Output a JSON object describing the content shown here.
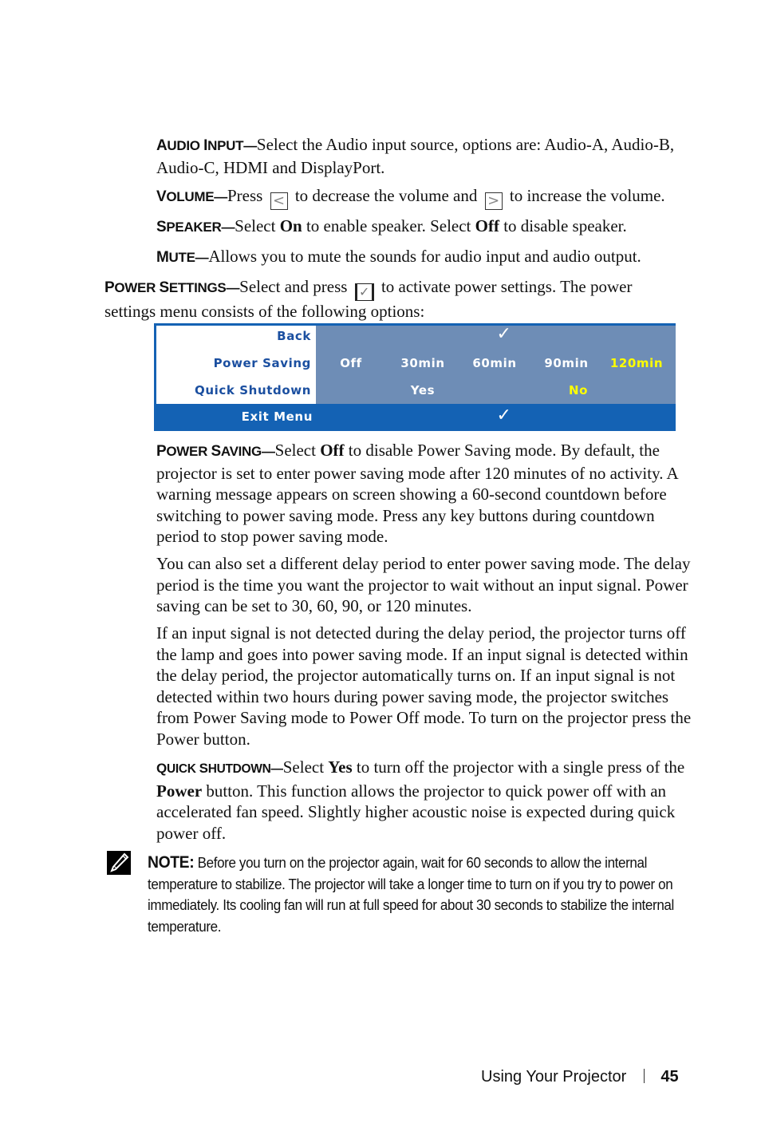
{
  "sections": {
    "audio_input": {
      "heading_first": "A",
      "heading_rest": "UDIO ",
      "heading_first2": "I",
      "heading_rest2": "NPUT",
      "dash": "—",
      "text": "Select the Audio input source, options are: Audio-A, Audio-B, Audio-C, HDMI and DisplayPort."
    },
    "volume": {
      "heading_first": "V",
      "heading_rest": "OLUME",
      "dash": "—",
      "text_before": "Press",
      "left_icon": "left-arrow-icon",
      "left_glyph": "<",
      "text_middle": "to decrease the volume and",
      "right_icon": "right-arrow-icon",
      "right_glyph": ">",
      "text_after": "to increase the volume."
    },
    "speaker": {
      "heading_first": "S",
      "heading_rest": "PEAKER",
      "dash": "—",
      "t1": "Select ",
      "b1": "On",
      "t2": " to enable speaker. Select ",
      "b2": "Off",
      "t3": " to disable speaker."
    },
    "mute": {
      "heading_first": "M",
      "heading_rest": "UTE",
      "dash": "—",
      "text": "Allows you to mute the sounds for audio input and audio output."
    },
    "power_settings": {
      "heading_first": "P",
      "heading_rest": "OWER ",
      "heading_first2": "S",
      "heading_rest2": "ETTINGS",
      "dash": "—",
      "text_before": "Select and press",
      "icon": "checkmark-button-icon",
      "glyph": "✓",
      "text_after": "to activate power settings. The power settings menu consists of the following options:"
    },
    "power_saving": {
      "heading_first": "P",
      "heading_rest": "OWER ",
      "heading_first2": "S",
      "heading_rest2": "AVING",
      "dash": "—",
      "t1": "Select ",
      "b1": "Off",
      "t2": " to disable Power Saving mode. By default, the projector is set to enter power saving mode after 120 minutes of no activity. A warning message appears on screen showing a 60-second countdown before switching to power saving mode. Press any key buttons during countdown period to stop power saving mode.",
      "p2": "You can also set a different delay period to enter power saving mode. The delay period is the time you want the projector to wait without an input signal. Power saving can be set to 30, 60, 90, or 120 minutes.",
      "p3": "If an input signal is not detected during the delay period, the projector turns off the lamp and goes into power saving mode. If an input signal is detected within the delay period, the projector automatically turns on. If an input signal is not detected within two hours during power saving mode, the projector switches from Power Saving mode to Power Off mode. To turn on the projector press the Power button."
    },
    "quick_shutdown": {
      "heading_first": "Q",
      "heading_rest": "UICK ",
      "heading_first2": "S",
      "heading_rest2": "HUTDOWN",
      "dash": "—",
      "t1": "Select ",
      "b1": "Yes",
      "t2": " to turn off the projector with a single press of the ",
      "b2": "Power",
      "t3": " button. This function allows the projector to quick power off with an accelerated fan speed. Slightly higher acoustic noise is expected during quick power off."
    }
  },
  "osd_menu": {
    "rows": [
      {
        "label": "Back",
        "options": [],
        "check": "✓"
      },
      {
        "label": "Power Saving",
        "options": [
          {
            "text": "Off",
            "selected": false
          },
          {
            "text": "30min",
            "selected": false
          },
          {
            "text": "60min",
            "selected": false
          },
          {
            "text": "90min",
            "selected": false
          },
          {
            "text": "120min",
            "selected": true
          }
        ]
      },
      {
        "label": "Quick Shutdown",
        "options": [
          {
            "text": "Yes",
            "selected": false
          },
          {
            "text": "No",
            "selected": true
          }
        ]
      }
    ],
    "exit_label": "Exit Menu",
    "exit_check": "✓",
    "colors": {
      "panel": "#6e8db6",
      "accent": "#1462b4",
      "label": "#1b4fa0",
      "selected": "#ffff00"
    }
  },
  "note": {
    "icon": "pencil-note-icon",
    "label": "NOTE:",
    "text": " Before you turn on the projector again, wait for 60 seconds to allow the internal temperature to stabilize. The projector will take a longer time to turn on if you try to power on immediately. Its cooling fan will run at full speed for about 30 seconds to stabilize the internal temperature."
  },
  "footer": {
    "section_title": "Using Your Projector",
    "page_number": "45"
  }
}
